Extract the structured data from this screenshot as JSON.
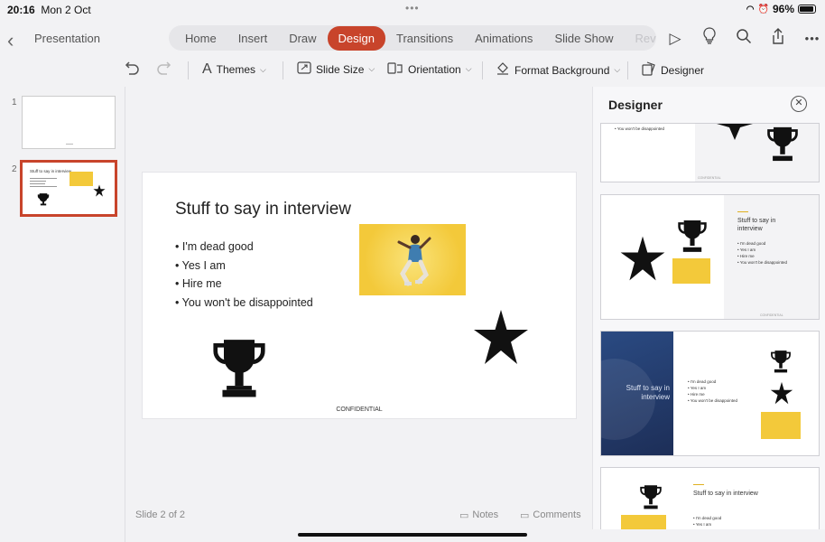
{
  "status_bar": {
    "time": "20:16",
    "date": "Mon 2 Oct",
    "battery_percent": "96%",
    "battery_level": 0.96
  },
  "topbar": {
    "back_label": "‹",
    "title": "Presentation",
    "tabs": [
      "Home",
      "Insert",
      "Draw",
      "Design",
      "Transitions",
      "Animations",
      "Slide Show",
      "Revie"
    ],
    "active_tab": "Design",
    "icons": [
      "play-icon",
      "lightbulb-icon",
      "search-icon",
      "share-icon",
      "more-icon"
    ]
  },
  "ribbon": {
    "themes": "Themes",
    "slide_size": "Slide Size",
    "orientation": "Orientation",
    "format_background": "Format Background",
    "designer": "Designer"
  },
  "sidebar": {
    "thumb1_num": "1",
    "thumb2_num": "2"
  },
  "slide": {
    "title": "Stuff to say in interview",
    "bullets": [
      "I'm dead good",
      "Yes I am",
      "Hire me",
      "You won't be disappointed"
    ],
    "footer": "CONFIDENTIAL"
  },
  "footer": {
    "slide_counter": "Slide 2 of 2",
    "notes": "Notes",
    "comments": "Comments"
  },
  "designer": {
    "title": "Designer",
    "close_icon": "close-icon",
    "card1_bullet": "• You won't be disappointed",
    "card_title": "Stuff to say in interview",
    "card_bullets": [
      "• I'm dead good",
      "• Yes I am",
      "• Hire me",
      "• You won't be disappointed"
    ],
    "conf": "CONFIDENTIAL"
  },
  "colors": {
    "accent": "#c8442b",
    "photo_yellow": "#f3c93a",
    "designer_dark": "#24396b"
  }
}
